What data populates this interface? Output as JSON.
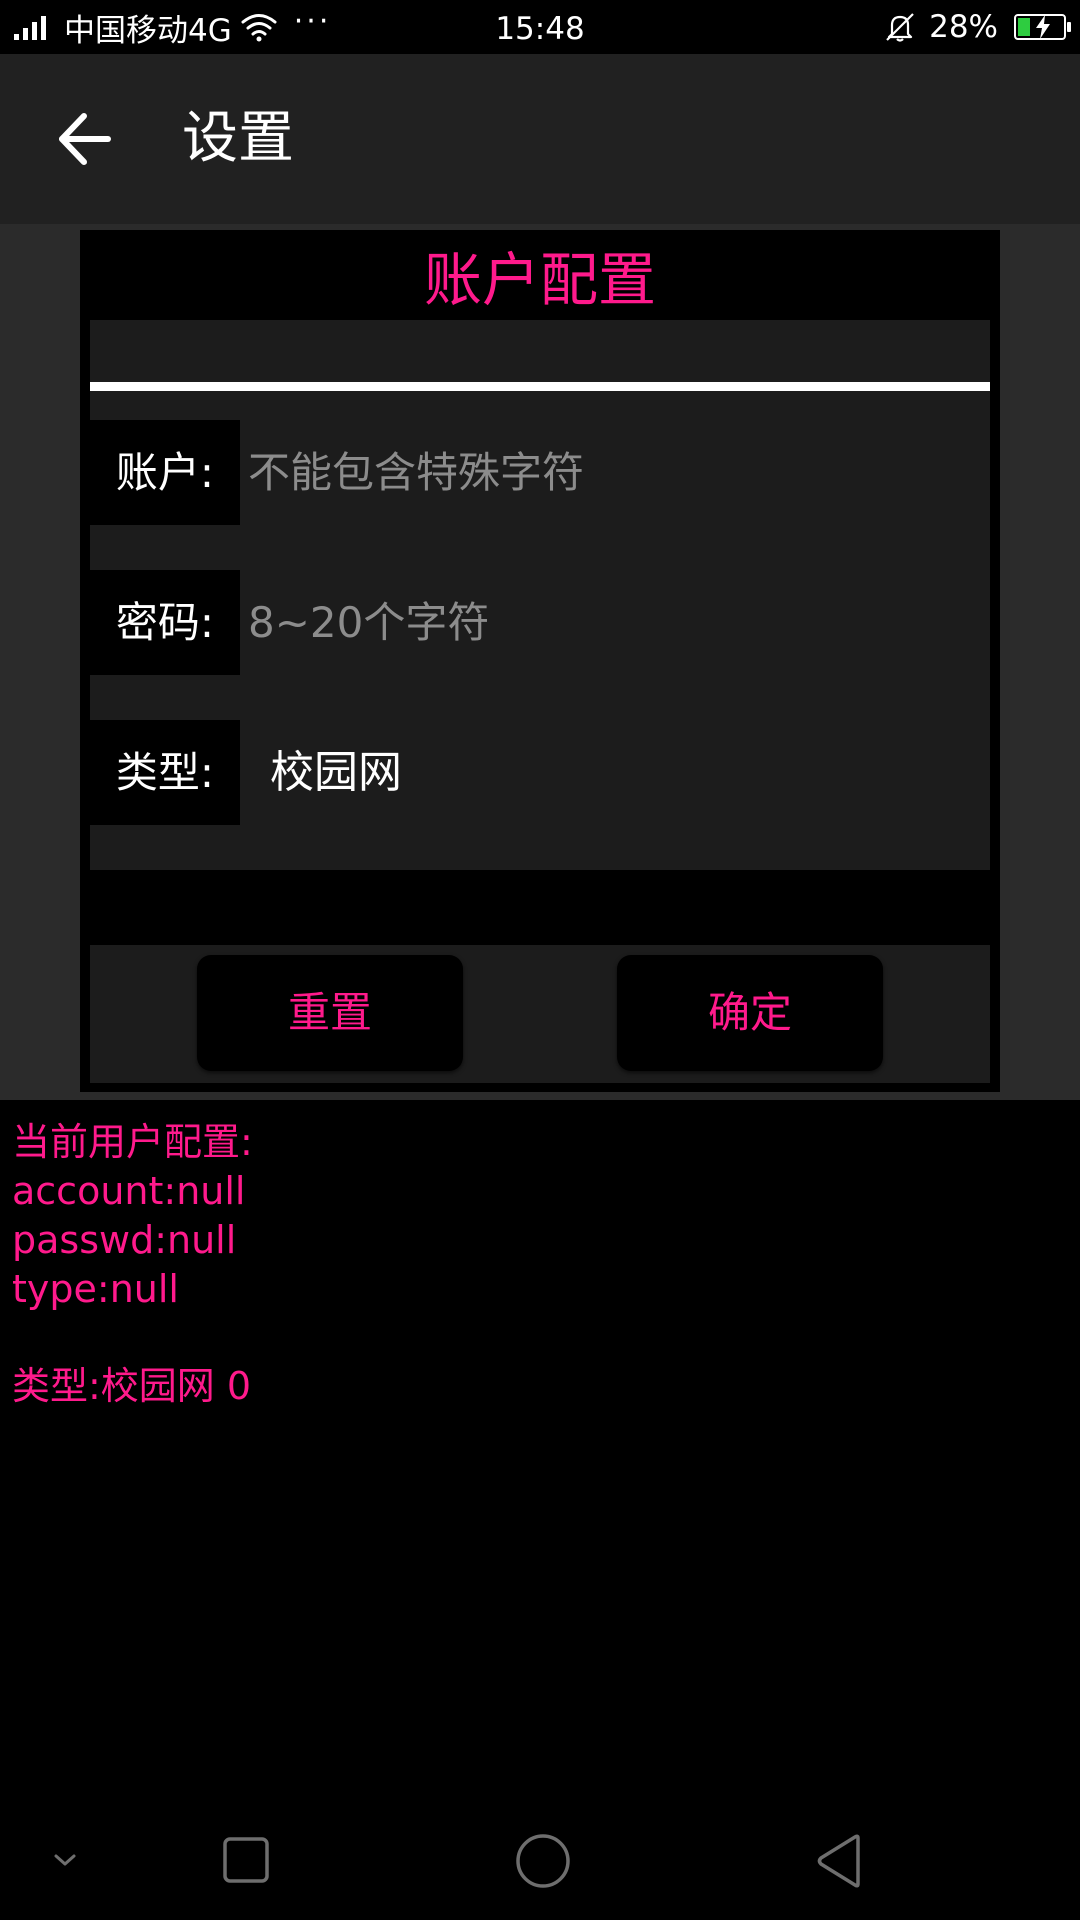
{
  "status_bar": {
    "carrier": "中国移动4G",
    "more_dots": "···",
    "time": "15:48",
    "battery_percent": "28%",
    "battery_level": 0.28,
    "icons": [
      "signal-icon",
      "wifi-icon",
      "bell-off-icon",
      "battery-icon"
    ]
  },
  "app_bar": {
    "title": "设置",
    "back_icon": "arrow-left-icon"
  },
  "dialog": {
    "title": "账户配置",
    "fields": [
      {
        "label": "账户:",
        "value": "",
        "placeholder": "不能包含特殊字符"
      },
      {
        "label": "密码:",
        "value": "",
        "placeholder": "8~20个字符"
      },
      {
        "label": "类型:",
        "value": "校园网"
      }
    ],
    "buttons": {
      "reset": "重置",
      "confirm": "确定"
    }
  },
  "info": {
    "lines": [
      "当前用户配置:",
      "account:null",
      "passwd:null",
      "type:null",
      "类型:校园网 0"
    ]
  },
  "nav_bar": {
    "icons": [
      "chevron-down-icon",
      "recents-square-icon",
      "home-circle-icon",
      "back-triangle-icon"
    ]
  },
  "colors": {
    "accent": "#ff1a8c",
    "app_bar": "#212121",
    "background": "#000000",
    "field_background": "#1c1c1c",
    "battery_fill": "#2ecc40"
  }
}
